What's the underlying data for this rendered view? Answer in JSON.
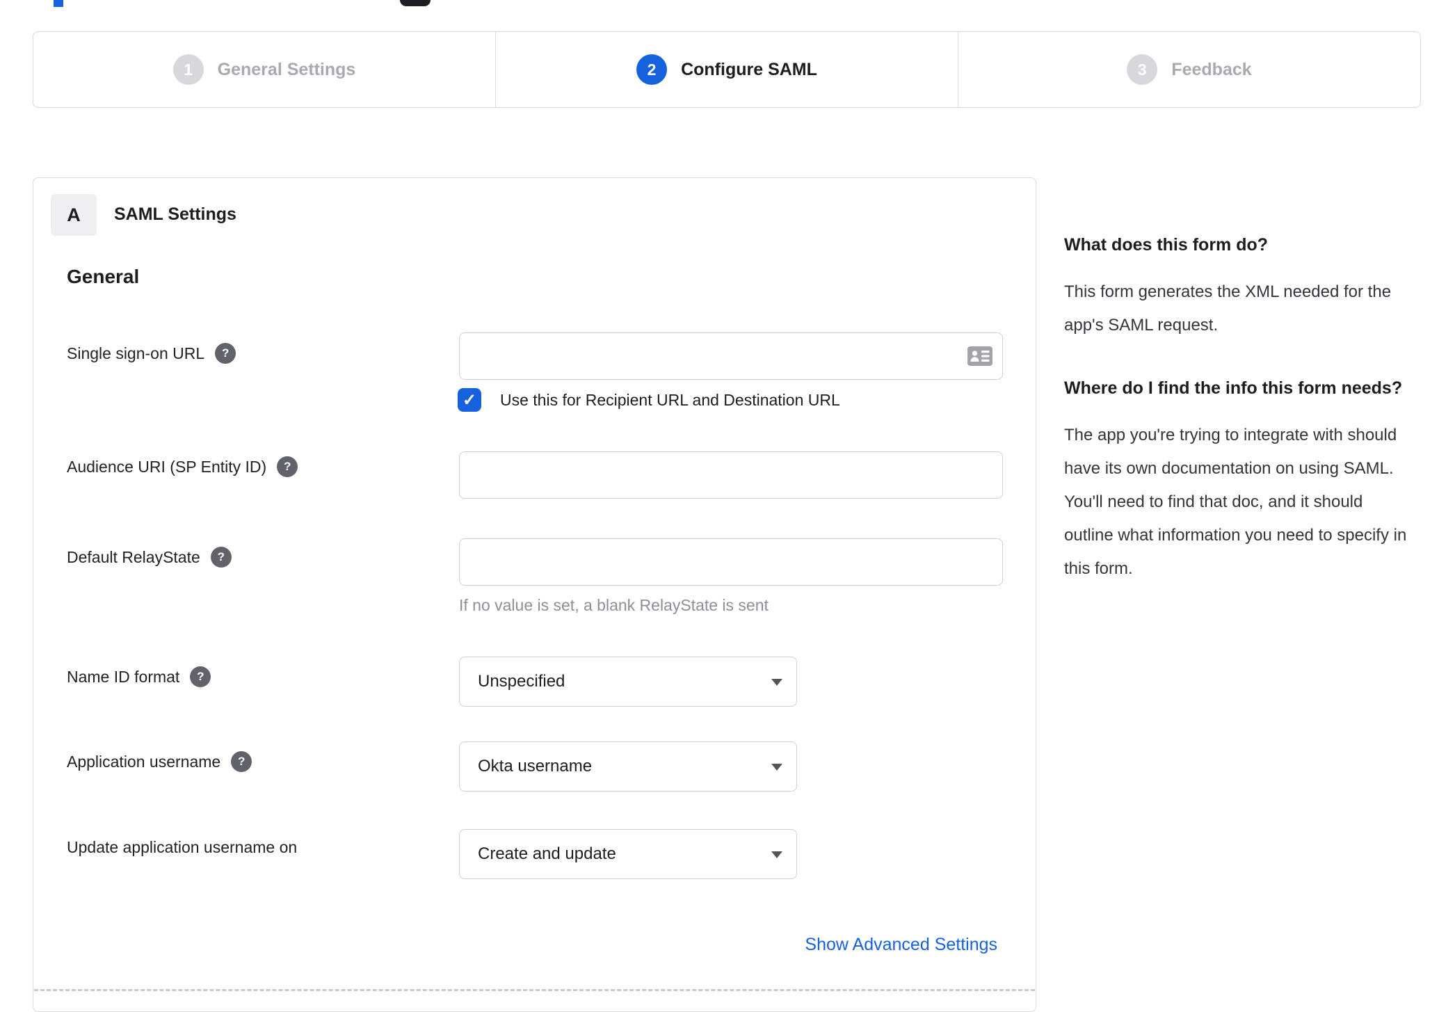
{
  "colors": {
    "accent": "#1662dd",
    "inactive_step": "#d8d8dc",
    "link": "#1662dd"
  },
  "stepper": {
    "steps": [
      {
        "number": "1",
        "label": "General Settings",
        "state": "inactive"
      },
      {
        "number": "2",
        "label": "Configure SAML",
        "state": "active"
      },
      {
        "number": "3",
        "label": "Feedback",
        "state": "inactive"
      }
    ]
  },
  "panel": {
    "section_badge": "A",
    "section_title": "SAML Settings",
    "group_heading": "General",
    "fields": {
      "sso_url": {
        "label": "Single sign-on URL",
        "value": "",
        "checkbox_label": "Use this for Recipient URL and Destination URL",
        "checkbox_checked": true
      },
      "audience_uri": {
        "label": "Audience URI (SP Entity ID)",
        "value": ""
      },
      "default_relaystate": {
        "label": "Default RelayState",
        "value": "",
        "hint": "If no value is set, a blank RelayState is sent"
      },
      "name_id_format": {
        "label": "Name ID format",
        "value": "Unspecified"
      },
      "application_username": {
        "label": "Application username",
        "value": "Okta username"
      },
      "update_app_username": {
        "label": "Update application username on",
        "value": "Create and update"
      }
    },
    "advanced_link": "Show Advanced Settings"
  },
  "sidebar": {
    "q1_heading": "What does this form do?",
    "q1_body": "This form generates the XML needed for the app's SAML request.",
    "q2_heading": "Where do I find the info this form needs?",
    "q2_body": "The app you're trying to integrate with should have its own documentation on using SAML. You'll need to find that doc, and it should outline what information you need to specify in this form."
  },
  "icons": {
    "help": "?",
    "checkbox_check": "✓",
    "sso_field_icon": "contact-card-icon",
    "select_caret": "caret-down-icon"
  }
}
